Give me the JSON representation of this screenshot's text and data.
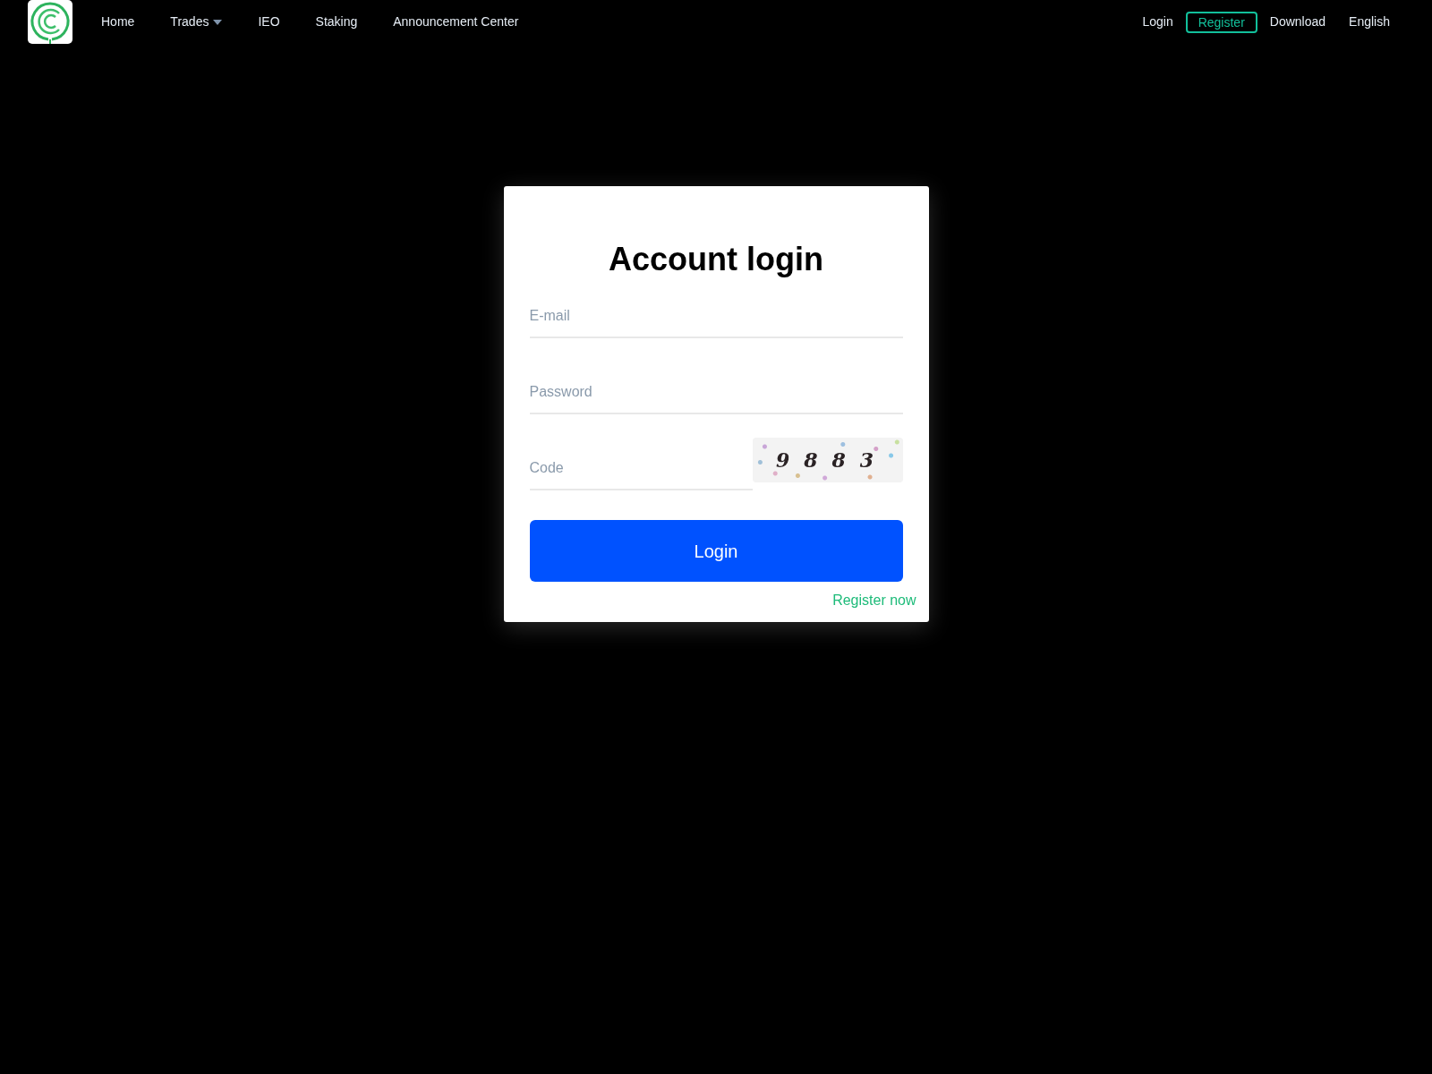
{
  "navbar": {
    "links": [
      {
        "label": "Home",
        "kind": "link"
      },
      {
        "label": "Trades",
        "kind": "dropdown"
      },
      {
        "label": "IEO",
        "kind": "link"
      },
      {
        "label": "Staking",
        "kind": "link"
      },
      {
        "label": "Announcement Center",
        "kind": "link"
      }
    ],
    "account": [
      {
        "label": "Login",
        "kind": "link"
      },
      {
        "label": "Register",
        "kind": "outline"
      },
      {
        "label": "Download",
        "kind": "link"
      },
      {
        "label": "English",
        "kind": "language"
      }
    ]
  },
  "login_form": {
    "title": "Account login",
    "fields": [
      {
        "placeholder": "E-mail",
        "kind": "email"
      },
      {
        "placeholder": "Password",
        "kind": "password"
      },
      {
        "placeholder": "Code",
        "kind": "captcha",
        "captcha": "9883"
      }
    ],
    "submit": "Login",
    "register_link": "Register now"
  }
}
